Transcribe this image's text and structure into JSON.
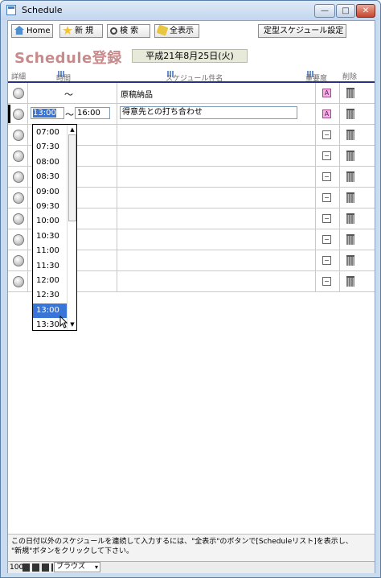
{
  "window": {
    "title": "Schedule",
    "controls": {
      "minimize": "—",
      "maximize": "□",
      "close": "✕"
    }
  },
  "toolbar": {
    "home_label": "Home",
    "new_label": "新 規",
    "search_label": "検 索",
    "show_all_label": "全表示",
    "template_label": "定型スケジュール設定"
  },
  "page": {
    "title": "Schedule登録",
    "date": "平成21年8月25日(火)"
  },
  "columns": {
    "detail": "詳細",
    "time": "時間",
    "subject": "スケジュール件名",
    "priority": "重要度",
    "delete": "削除"
  },
  "rows": [
    {
      "start": "",
      "end": "",
      "tilde": "～",
      "subject": "原稿納品",
      "priority": "A"
    },
    {
      "start": "13:00",
      "end": "16:00",
      "tilde": "～",
      "subject": "得意先との打ち合わせ",
      "priority": "A"
    },
    {
      "priority": "−"
    },
    {
      "priority": "−"
    },
    {
      "priority": "−"
    },
    {
      "priority": "−"
    },
    {
      "priority": "−"
    },
    {
      "priority": "−"
    },
    {
      "priority": "−"
    },
    {
      "priority": "−"
    }
  ],
  "time_dropdown": {
    "options": [
      "07:00",
      "07:30",
      "08:00",
      "08:30",
      "09:00",
      "09:30",
      "10:00",
      "10:30",
      "11:00",
      "11:30",
      "12:00",
      "12:30",
      "13:00",
      "13:30"
    ],
    "selected": "13:00",
    "scroll_up": "▲",
    "scroll_down": "▼"
  },
  "footnote": {
    "line1": "この日付以外のスケジュールを連続して入力するには、\"全表示\"のボタンで[Scheduleリスト]を表示し、",
    "line2": "\"新規\"ボタンをクリックして下さい。"
  },
  "statusbar": {
    "zoom": "100",
    "mode": "ブラウズ"
  },
  "colors": {
    "title_pink": "#c88a8a",
    "header_rule": "#2b2f86",
    "selection_blue": "#3875d7",
    "priority_a": "#f4b3e6"
  }
}
